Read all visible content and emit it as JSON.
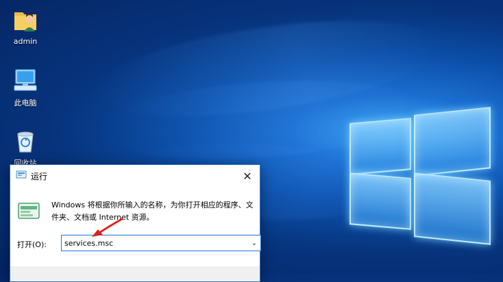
{
  "desktop": {
    "icons": [
      {
        "label": "admin",
        "icon": "user-folder-icon"
      },
      {
        "label": "此电脑",
        "icon": "computer-icon"
      },
      {
        "label": "回收站",
        "icon": "recycle-bin-icon"
      }
    ]
  },
  "run_dialog": {
    "title": "运行",
    "close_glyph": "✕",
    "description": "Windows 将根据你所输入的名称，为你打开相应的程序、文件夹、文档或 Internet 资源。",
    "open_label": "打开(O):",
    "input_value": "services.msc",
    "dropdown_glyph": "⌄"
  },
  "colors": {
    "desktop_dark": "#052563",
    "desktop_light": "#3fa9f5",
    "dialog_border": "#2b6fc5",
    "input_border": "#1e73d8",
    "annotation_arrow": "#e02020"
  }
}
